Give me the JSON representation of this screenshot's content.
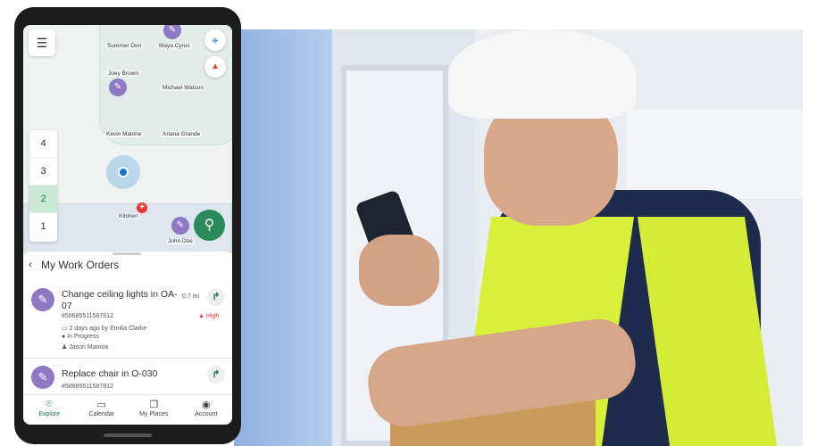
{
  "map": {
    "rooms": [
      "Summer Don",
      "Maya Cyrus",
      "Joey Brown",
      "Michael Watson",
      "Kevin Malone",
      "Ariana Grande",
      "Kitchen",
      "John Doe"
    ],
    "floors": [
      "4",
      "3",
      "2",
      "1"
    ],
    "active_floor": "2",
    "menu_icon": "hamburger-icon",
    "locate_icon": "crosshair-icon",
    "compass_icon": "compass-icon",
    "search_icon": "search-icon",
    "accent": "#1e7b4e"
  },
  "panel": {
    "title": "My Work Orders",
    "orders": [
      {
        "title": "Change ceiling lights in OA-07",
        "id": "#58685511587812",
        "distance": "0.7 mi",
        "priority": "High",
        "created": "2 days ago by Emilia Clarke",
        "status": "In Progress",
        "assignee": "Jason Mamoa"
      },
      {
        "title": "Replace chair in O-030",
        "id": "#58685511587812"
      }
    ]
  },
  "nav": [
    {
      "label": "Explore",
      "icon": "location-pin-icon"
    },
    {
      "label": "Calendar",
      "icon": "calendar-icon"
    },
    {
      "label": "My Places",
      "icon": "bookmarks-icon"
    },
    {
      "label": "Account",
      "icon": "account-icon"
    }
  ]
}
